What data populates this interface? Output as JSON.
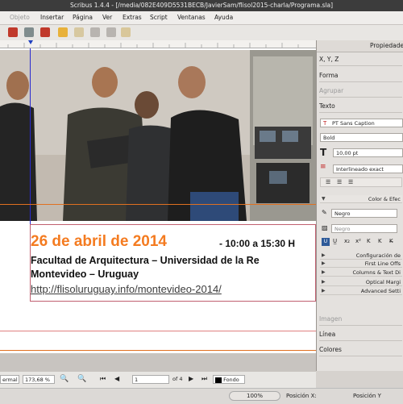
{
  "window": {
    "title": "Scribus 1.4.4 - [/media/082E409D5531BECB/JavierSam/flisol2015-charla/Programa.sla]"
  },
  "menu": [
    "Objeto",
    "Insertar",
    "Página",
    "Ver",
    "Extras",
    "Script",
    "Ventanas",
    "Ayuda"
  ],
  "document": {
    "date": "26 de abril de 2014",
    "time": " - 10:00 a 15:30 H",
    "place": "Facultad de Arquitectura – Universidad de la Re",
    "city": "Montevideo – Uruguay",
    "url": "http://flisoluruguay.info/montevideo-2014/"
  },
  "statusbar": {
    "mode": "ermal",
    "zoom": "173,68 %",
    "page": "1",
    "of_pages": "of 4",
    "layer": "Fondo"
  },
  "bottombar": {
    "zoom": "100%",
    "pos_x_label": "Posición X:",
    "pos_y_label": "Posición Y"
  },
  "panel": {
    "title": "Propiedades",
    "xyz": "X, Y, Z",
    "forma": "Forma",
    "agrupar": "Agrupar",
    "texto": "Texto",
    "font": "PT Sans Caption",
    "style": "Bold",
    "size": "10,00 pt",
    "line_spacing": "Interlineado exact",
    "color_section": "Color & Efec",
    "color1": "Negro",
    "color2": "Negro",
    "sub_sections": [
      "Configuración de",
      "First Line Offs",
      "Columns & Text Di",
      "Optical Margi",
      "Advanced Setti"
    ],
    "imagen": "Imagen",
    "linea": "Línea",
    "colores": "Colores"
  },
  "colors": {
    "accent_orange": "#f47b20",
    "url_gray": "#3c3c3c",
    "window_dark": "#3c3c3c"
  }
}
